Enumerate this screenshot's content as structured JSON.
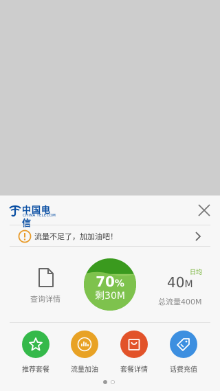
{
  "brand": {
    "name_cn": "中国电信",
    "name_en": "CHINA TELECOM",
    "color": "#0a4fa3"
  },
  "notice": {
    "text": "流量不足了，加加油吧！",
    "warn_color": "#e89b2a"
  },
  "stats": {
    "query_label": "查询详情",
    "percent": "70",
    "percent_sign": "%",
    "percent_value": 0.7,
    "remaining": "剩30M",
    "daily_avg_label": "日均",
    "daily_value": "40",
    "daily_unit": "M",
    "total_label": "总流量400M"
  },
  "actions": [
    {
      "label": "推荐套餐",
      "icon": "star-icon",
      "color": "#35b94a"
    },
    {
      "label": "流量加油",
      "icon": "signal-bars-icon",
      "color": "#e8a225"
    },
    {
      "label": "套餐详情",
      "icon": "shopping-bag-icon",
      "color": "#e2532a"
    },
    {
      "label": "话费充值",
      "icon": "price-tag-icon",
      "color": "#3d8fe0"
    }
  ],
  "pager": {
    "current": 1,
    "total": 2
  }
}
